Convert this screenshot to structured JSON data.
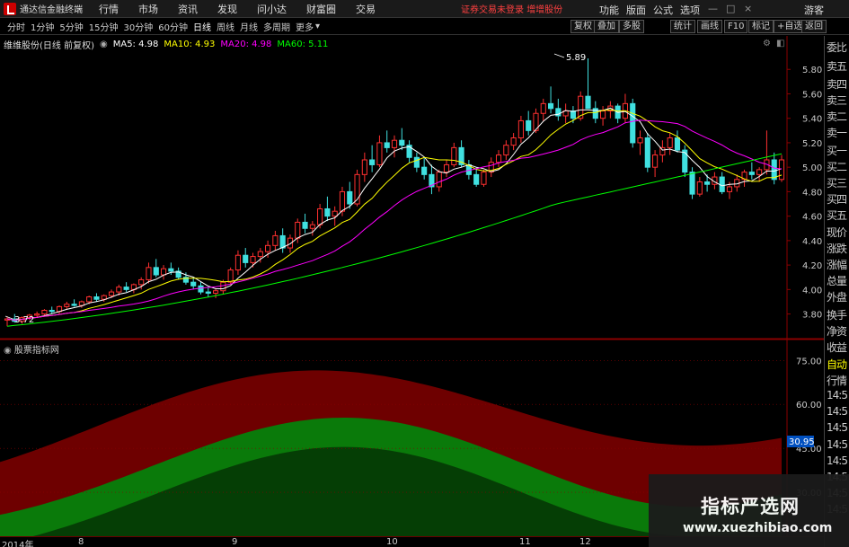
{
  "menubar": {
    "app_name": "通达信金融终端",
    "items": [
      "行情",
      "市场",
      "资讯",
      "发现",
      "问小达",
      "财富圈",
      "交易"
    ],
    "warning": "证券交易未登录",
    "warning2": "增增股份",
    "right_items": [
      "功能",
      "版面",
      "公式",
      "选项"
    ],
    "guest": "游客",
    "window_controls": [
      "minimize-icon",
      "maximize-icon",
      "close-icon"
    ]
  },
  "toolbar": {
    "periods": [
      "分时",
      "1分钟",
      "5分钟",
      "15分钟",
      "30分钟",
      "60分钟",
      "日线",
      "周线",
      "月线",
      "多周期",
      "更多"
    ],
    "active_period": "日线",
    "right_buttons": [
      "复权",
      "叠加",
      "多股",
      "统计",
      "画线",
      "F10",
      "标记",
      "+自选",
      "返回"
    ]
  },
  "info": {
    "stock": "维维股份(日线 前复权)",
    "ma5": "MA5: 4.98",
    "ma10": "MA10: 4.93",
    "ma20": "MA20: 4.98",
    "ma60": "MA60: 5.11",
    "colors": {
      "ma5": "#ffffff",
      "ma10": "#ffff00",
      "ma20": "#ff00ff",
      "ma60": "#00ff00"
    }
  },
  "price_axis": [
    "5.80",
    "5.60",
    "5.40",
    "5.20",
    "5.00",
    "4.80",
    "4.60",
    "4.40",
    "4.20",
    "4.00",
    "3.80"
  ],
  "annotations": {
    "high": "5.89",
    "low": "3.72"
  },
  "sub_panel": {
    "label": "股票指标网",
    "axis": [
      "75.00",
      "60.00",
      "45.00",
      "30.00"
    ],
    "current_value": "30.95"
  },
  "right_panel": {
    "items": [
      "委比",
      "卖五",
      "卖四",
      "卖三",
      "卖二",
      "卖一",
      "买一",
      "买二",
      "买三",
      "买四",
      "买五",
      "现价",
      "涨跌",
      "涨幅",
      "总量",
      "外盘",
      "换手",
      "净资",
      "收益",
      "自动",
      "行情",
      "14:5",
      "14:5",
      "14:5",
      "14:5",
      "14:5",
      "14:5",
      "14:5",
      "14:5"
    ]
  },
  "x_axis": [
    "2014年",
    "8",
    "9",
    "10",
    "11",
    "12"
  ],
  "watermark": {
    "title": "指标严选网",
    "url": "www.xuezhibiao.com"
  },
  "chart_data": {
    "type": "candlestick",
    "ylim": [
      3.65,
      6.0
    ],
    "up_color": "#ff3030",
    "down_color": "#40e0e0",
    "candles": [
      [
        3.75,
        3.78,
        3.7,
        3.76
      ],
      [
        3.76,
        3.8,
        3.73,
        3.74
      ],
      [
        3.74,
        3.78,
        3.72,
        3.77
      ],
      [
        3.77,
        3.8,
        3.75,
        3.79
      ],
      [
        3.79,
        3.82,
        3.77,
        3.8
      ],
      [
        3.8,
        3.84,
        3.78,
        3.83
      ],
      [
        3.83,
        3.86,
        3.8,
        3.82
      ],
      [
        3.82,
        3.87,
        3.8,
        3.86
      ],
      [
        3.86,
        3.9,
        3.84,
        3.88
      ],
      [
        3.88,
        3.92,
        3.86,
        3.87
      ],
      [
        3.87,
        3.91,
        3.85,
        3.9
      ],
      [
        3.9,
        3.95,
        3.88,
        3.94
      ],
      [
        3.94,
        3.97,
        3.9,
        3.92
      ],
      [
        3.92,
        3.96,
        3.9,
        3.95
      ],
      [
        3.95,
        4.0,
        3.93,
        3.98
      ],
      [
        3.98,
        4.04,
        3.95,
        4.02
      ],
      [
        4.02,
        4.06,
        3.98,
        4.0
      ],
      [
        4.0,
        4.05,
        3.97,
        4.04
      ],
      [
        4.04,
        4.1,
        4.0,
        4.08
      ],
      [
        4.08,
        4.22,
        4.05,
        4.18
      ],
      [
        4.18,
        4.25,
        4.1,
        4.12
      ],
      [
        4.12,
        4.2,
        4.08,
        4.17
      ],
      [
        4.17,
        4.22,
        4.12,
        4.15
      ],
      [
        4.15,
        4.18,
        4.08,
        4.1
      ],
      [
        4.1,
        4.14,
        4.04,
        4.06
      ],
      [
        4.06,
        4.1,
        4.0,
        4.03
      ],
      [
        4.03,
        4.06,
        3.96,
        3.98
      ],
      [
        3.98,
        4.02,
        3.94,
        3.97
      ],
      [
        3.97,
        4.01,
        3.93,
        3.99
      ],
      [
        3.99,
        4.08,
        3.96,
        4.06
      ],
      [
        4.06,
        4.18,
        4.04,
        4.16
      ],
      [
        4.16,
        4.32,
        4.12,
        4.28
      ],
      [
        4.28,
        4.34,
        4.18,
        4.22
      ],
      [
        4.22,
        4.3,
        4.18,
        4.27
      ],
      [
        4.27,
        4.34,
        4.22,
        4.31
      ],
      [
        4.31,
        4.4,
        4.26,
        4.36
      ],
      [
        4.36,
        4.48,
        4.32,
        4.44
      ],
      [
        4.44,
        4.5,
        4.3,
        4.34
      ],
      [
        4.34,
        4.45,
        4.3,
        4.42
      ],
      [
        4.42,
        4.58,
        4.38,
        4.55
      ],
      [
        4.55,
        4.62,
        4.46,
        4.5
      ],
      [
        4.5,
        4.56,
        4.44,
        4.53
      ],
      [
        4.53,
        4.7,
        4.5,
        4.66
      ],
      [
        4.66,
        4.76,
        4.56,
        4.6
      ],
      [
        4.6,
        4.68,
        4.52,
        4.64
      ],
      [
        4.64,
        4.84,
        4.6,
        4.8
      ],
      [
        4.8,
        4.88,
        4.66,
        4.7
      ],
      [
        4.7,
        4.98,
        4.68,
        4.94
      ],
      [
        4.94,
        5.12,
        4.88,
        5.06
      ],
      [
        5.06,
        5.18,
        4.96,
        5.02
      ],
      [
        5.02,
        5.26,
        5.0,
        5.2
      ],
      [
        5.2,
        5.3,
        5.12,
        5.16
      ],
      [
        5.16,
        5.26,
        5.08,
        5.22
      ],
      [
        5.22,
        5.32,
        5.14,
        5.18
      ],
      [
        5.18,
        5.22,
        5.04,
        5.08
      ],
      [
        5.08,
        5.12,
        4.96,
        5.0
      ],
      [
        5.0,
        5.08,
        4.9,
        4.94
      ],
      [
        4.94,
        5.02,
        4.78,
        4.84
      ],
      [
        4.84,
        4.98,
        4.8,
        4.96
      ],
      [
        4.96,
        5.06,
        4.92,
        5.02
      ],
      [
        5.02,
        5.2,
        5.0,
        5.16
      ],
      [
        5.16,
        5.22,
        5.0,
        5.02
      ],
      [
        5.02,
        5.06,
        4.9,
        4.94
      ],
      [
        4.94,
        5.0,
        4.84,
        4.86
      ],
      [
        4.86,
        4.98,
        4.84,
        4.96
      ],
      [
        4.96,
        5.08,
        4.92,
        5.04
      ],
      [
        5.04,
        5.14,
        5.0,
        5.1
      ],
      [
        5.1,
        5.22,
        5.06,
        5.18
      ],
      [
        5.18,
        5.28,
        5.14,
        5.24
      ],
      [
        5.24,
        5.42,
        5.2,
        5.38
      ],
      [
        5.38,
        5.46,
        5.26,
        5.3
      ],
      [
        5.3,
        5.48,
        5.28,
        5.44
      ],
      [
        5.44,
        5.56,
        5.38,
        5.52
      ],
      [
        5.52,
        5.66,
        5.44,
        5.48
      ],
      [
        5.48,
        5.56,
        5.38,
        5.42
      ],
      [
        5.42,
        5.52,
        5.36,
        5.46
      ],
      [
        5.46,
        5.5,
        5.36,
        5.4
      ],
      [
        5.4,
        5.62,
        5.38,
        5.58
      ],
      [
        5.58,
        5.89,
        5.54,
        5.48
      ],
      [
        5.48,
        5.54,
        5.36,
        5.4
      ],
      [
        5.4,
        5.5,
        5.34,
        5.46
      ],
      [
        5.46,
        5.54,
        5.4,
        5.5
      ],
      [
        5.5,
        5.52,
        5.36,
        5.4
      ],
      [
        5.4,
        5.6,
        5.36,
        5.52
      ],
      [
        5.52,
        5.56,
        5.16,
        5.2
      ],
      [
        5.2,
        5.3,
        5.1,
        5.24
      ],
      [
        5.24,
        5.28,
        4.96,
        5.0
      ],
      [
        5.0,
        5.14,
        4.92,
        5.1
      ],
      [
        5.1,
        5.22,
        5.04,
        5.16
      ],
      [
        5.16,
        5.28,
        5.1,
        5.24
      ],
      [
        5.24,
        5.3,
        5.12,
        5.14
      ],
      [
        5.14,
        5.18,
        4.92,
        4.96
      ],
      [
        4.96,
        5.0,
        4.74,
        4.78
      ],
      [
        4.78,
        4.92,
        4.76,
        4.88
      ],
      [
        4.88,
        4.94,
        4.8,
        4.86
      ],
      [
        4.86,
        4.96,
        4.82,
        4.92
      ],
      [
        4.92,
        4.96,
        4.78,
        4.8
      ],
      [
        4.8,
        4.88,
        4.74,
        4.84
      ],
      [
        4.84,
        4.94,
        4.8,
        4.9
      ],
      [
        4.9,
        4.98,
        4.84,
        4.96
      ],
      [
        4.96,
        5.04,
        4.9,
        4.94
      ],
      [
        4.94,
        5.0,
        4.88,
        4.98
      ],
      [
        4.98,
        5.3,
        4.94,
        5.06
      ],
      [
        5.06,
        5.12,
        4.86,
        4.9
      ],
      [
        4.9,
        5.1,
        4.88,
        5.06
      ]
    ]
  }
}
